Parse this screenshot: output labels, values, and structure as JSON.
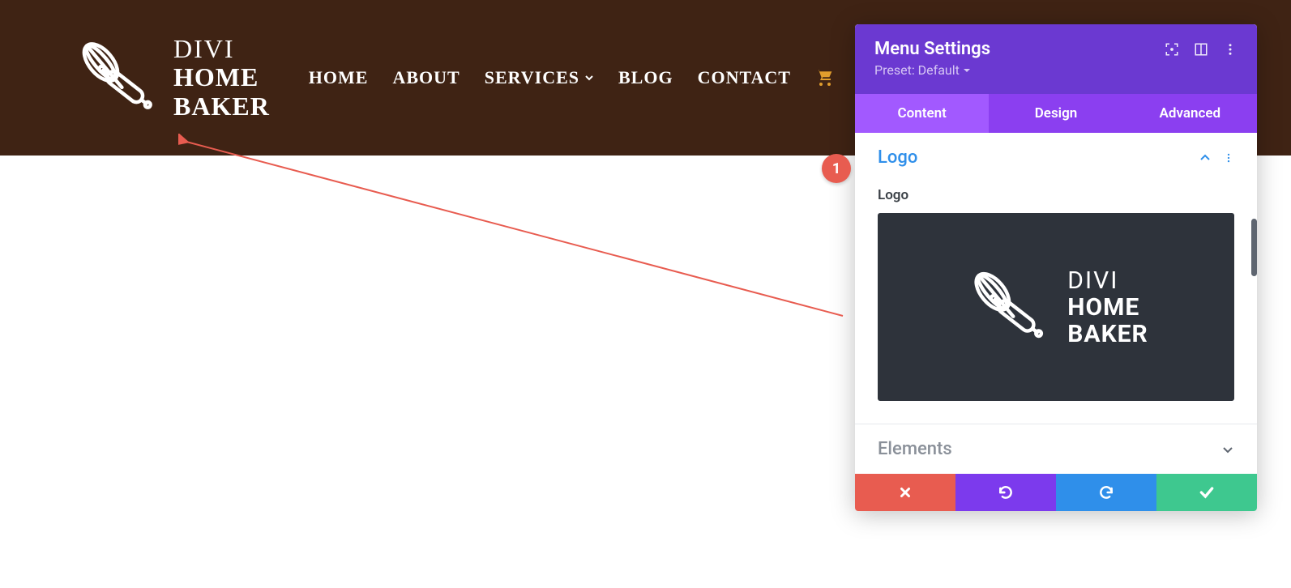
{
  "header": {
    "logo": {
      "line1": "DIVI",
      "line2": "HOME",
      "line3": "BAKER"
    },
    "nav": [
      {
        "label": "HOME",
        "has_dropdown": false
      },
      {
        "label": "ABOUT",
        "has_dropdown": false
      },
      {
        "label": "SERVICES",
        "has_dropdown": true
      },
      {
        "label": "BLOG",
        "has_dropdown": false
      },
      {
        "label": "CONTACT",
        "has_dropdown": false
      }
    ]
  },
  "annotation": {
    "badge": "1"
  },
  "panel": {
    "title": "Menu Settings",
    "preset_label": "Preset: Default",
    "tabs": [
      {
        "label": "Content",
        "active": true
      },
      {
        "label": "Design",
        "active": false
      },
      {
        "label": "Advanced",
        "active": false
      }
    ],
    "sections": {
      "logo": {
        "title": "Logo",
        "field_label": "Logo",
        "preview_text": {
          "line1": "DIVI",
          "line2": "HOME",
          "line3": "BAKER"
        }
      },
      "elements": {
        "title": "Elements"
      }
    }
  }
}
